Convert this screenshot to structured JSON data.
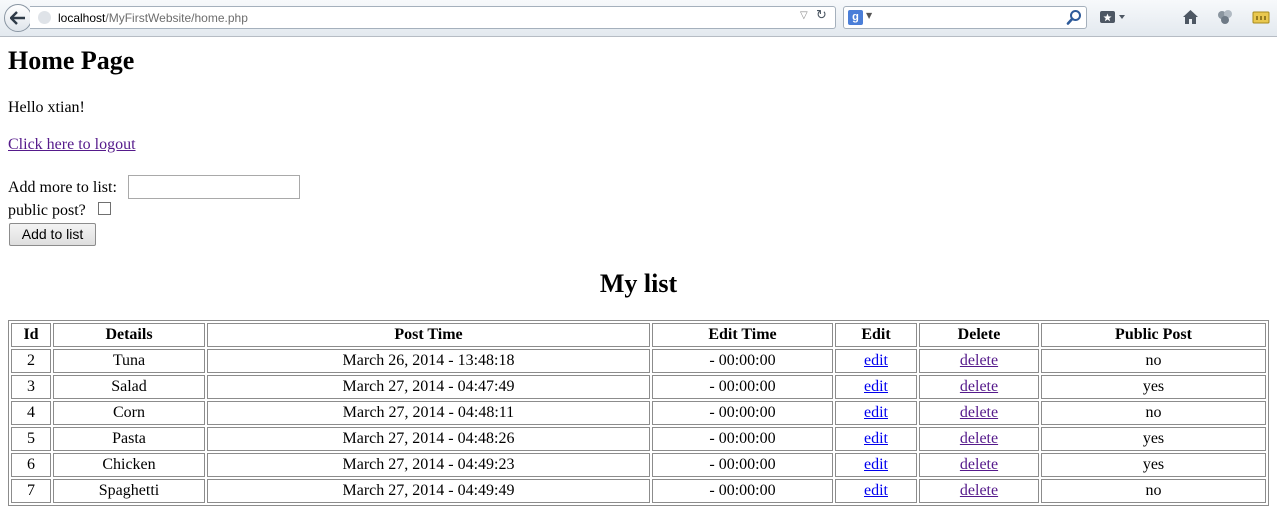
{
  "browser": {
    "url_host": "localhost",
    "url_path": "/MyFirstWebsite/home.php",
    "search_engine_letter": "g",
    "search_value": ""
  },
  "page": {
    "title": "Home Page",
    "greeting": "Hello xtian!",
    "logout_link": "Click here to logout",
    "add_label": "Add more to list:",
    "add_input_value": "",
    "public_label": "public post?",
    "public_checked": false,
    "add_button": "Add to list",
    "list_title": "My list"
  },
  "table": {
    "headers": [
      "Id",
      "Details",
      "Post Time",
      "Edit Time",
      "Edit",
      "Delete",
      "Public Post"
    ],
    "rows": [
      {
        "id": "2",
        "details": "Tuna",
        "post_time": "March 26, 2014 - 13:48:18",
        "edit_time": "- 00:00:00",
        "edit": "edit",
        "delete": "delete",
        "public": "no"
      },
      {
        "id": "3",
        "details": "Salad",
        "post_time": "March 27, 2014 - 04:47:49",
        "edit_time": "- 00:00:00",
        "edit": "edit",
        "delete": "delete",
        "public": "yes"
      },
      {
        "id": "4",
        "details": "Corn",
        "post_time": "March 27, 2014 - 04:48:11",
        "edit_time": "- 00:00:00",
        "edit": "edit",
        "delete": "delete",
        "public": "no"
      },
      {
        "id": "5",
        "details": "Pasta",
        "post_time": "March 27, 2014 - 04:48:26",
        "edit_time": "- 00:00:00",
        "edit": "edit",
        "delete": "delete",
        "public": "yes"
      },
      {
        "id": "6",
        "details": "Chicken",
        "post_time": "March 27, 2014 - 04:49:23",
        "edit_time": "- 00:00:00",
        "edit": "edit",
        "delete": "delete",
        "public": "yes"
      },
      {
        "id": "7",
        "details": "Spaghetti",
        "post_time": "March 27, 2014 - 04:49:49",
        "edit_time": "- 00:00:00",
        "edit": "edit",
        "delete": "delete",
        "public": "no"
      }
    ]
  },
  "colors": {
    "link_unvisited": "#0000ee",
    "link_visited": "#551a8b"
  },
  "icons": [
    "back-arrow-icon",
    "site-identity-icon",
    "dropdown-arrow-icon",
    "reload-icon",
    "google-icon",
    "search-icon",
    "bookmarks-icon",
    "home-icon",
    "addons-icon",
    "notification-icon"
  ]
}
